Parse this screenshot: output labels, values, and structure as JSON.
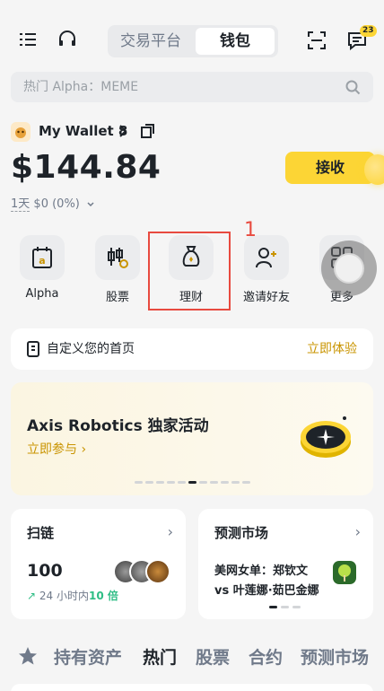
{
  "header": {
    "tab_exchange": "交易平台",
    "tab_wallet": "钱包",
    "chat_badge": "23"
  },
  "search": {
    "placeholder": "热门 Alpha：MEME"
  },
  "wallet": {
    "name": "My Wallet 8",
    "balance": "$144.84",
    "change_period": "1天",
    "change_value": "$0 (0%)",
    "receive_label": "接收"
  },
  "shortcuts": [
    {
      "label": "Alpha",
      "icon": "alpha-icon"
    },
    {
      "label": "股票",
      "icon": "stocks-icon"
    },
    {
      "label": "理财",
      "icon": "earn-bag-icon"
    },
    {
      "label": "邀请好友",
      "icon": "invite-friend-icon"
    },
    {
      "label": "更多",
      "icon": "more-grid-icon"
    }
  ],
  "annotation_number": "1",
  "customize": {
    "text": "自定义您的首页",
    "link": "立即体验"
  },
  "banner": {
    "title": "Axis Robotics 独家活动",
    "link": "立即参与 ›"
  },
  "scan_card": {
    "title": "扫链",
    "value": "100",
    "sub_prefix": "24 小时内",
    "sub_highlight": "10 倍"
  },
  "predict_card": {
    "title": "预测市场",
    "line1": "美网女单：郑钦文",
    "line2": "vs 叶莲娜·茹巴金娜"
  },
  "bottom_tabs": [
    "持有资产",
    "热门",
    "股票",
    "合约",
    "预测市场"
  ],
  "colors": {
    "brand_yellow": "#fcd535",
    "link_gold": "#c99400",
    "highlight_red": "#e84a3f",
    "positive_green": "#2ebd85"
  }
}
